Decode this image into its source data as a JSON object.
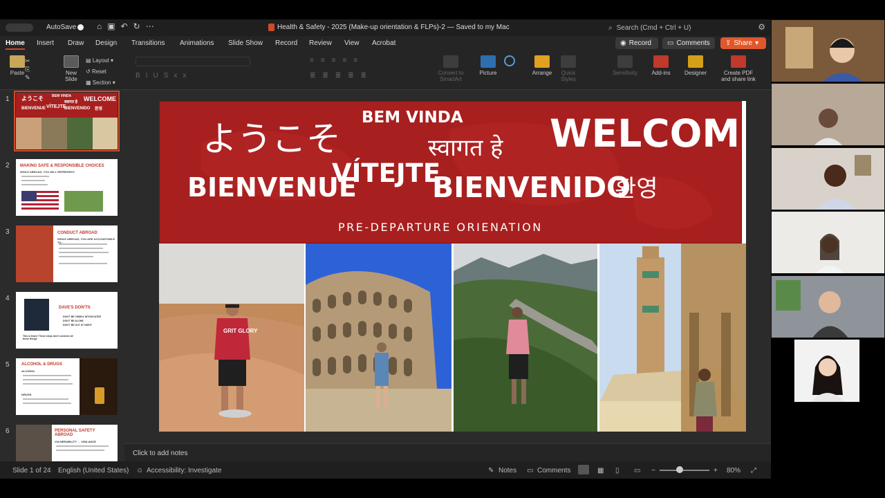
{
  "titlebar": {
    "autosave_label": "AutoSave",
    "document_title": "Health & Safety - 2025 (Make-up orientation & FLPs)-2 — Saved to my Mac",
    "search_placeholder": "Search (Cmd + Ctrl + U)"
  },
  "tabs": [
    "Home",
    "Insert",
    "Draw",
    "Design",
    "Transitions",
    "Animations",
    "Slide Show",
    "Record",
    "Review",
    "View",
    "Acrobat"
  ],
  "actions": {
    "record": "Record",
    "comments": "Comments",
    "share": "Share"
  },
  "ribbon": {
    "paste": "Paste",
    "new_slide": "New Slide",
    "layout": "Layout",
    "reset": "Reset",
    "section": "Section",
    "convert_smartart": "Convert to SmartArt",
    "picture": "Picture",
    "arrange": "Arrange",
    "quick_styles": "Quick Styles",
    "sensitivity": "Sensitivity",
    "addins": "Add-ins",
    "designer": "Designer",
    "create_pdf": "Create PDF and share link"
  },
  "thumbnails": [
    {
      "num": "1",
      "words": [
        "ようこそ",
        "BEM VINDA",
        "स्वागत हे",
        "WELCOME",
        "BIENVENUE",
        "VÍTEJTE",
        "BIENVENIDO",
        "환영"
      ]
    },
    {
      "num": "2",
      "title": "MAKING SAFE & RESPONSIBLE CHOICES",
      "sub": "WHILE ABROAD, YOU WILL REPRESENT:"
    },
    {
      "num": "3",
      "title": "CONDUCT ABROAD",
      "sub": "WHILE ABROAD, YOU ARE ACCOUNTABLE TO:"
    },
    {
      "num": "4",
      "title": "DAVE'S DON'TS",
      "items": [
        "DON'T BE VISIBLY INTOXICATED",
        "DON'T BE ALONE",
        "DON'T BE OUT AT NIGHT"
      ],
      "caption": "This is Dave! These steps don't condone all these things"
    },
    {
      "num": "5",
      "title": "ALCOHOL & DRUGS",
      "sub": "ALCOHOL",
      "sub2": "DRUGS"
    },
    {
      "num": "6",
      "title": "PERSONAL SAFETY ABROAD",
      "sub": "VULNERABILITY → VIGILANCE"
    }
  ],
  "slide": {
    "words": {
      "japanese": "ようこそ",
      "portuguese": "BEM VINDA",
      "hindi": "स्वागत हे",
      "english": "WELCOME",
      "french": "BIENVENUE",
      "czech": "VÍTEJTE",
      "spanish": "BIENVENIDO",
      "korean": "환영"
    },
    "subtitle": "PRE-DEPARTURE ORIENATION",
    "shirt_text": "GRIT GLORY"
  },
  "notes_placeholder": "Click to add notes",
  "status": {
    "slide_count": "Slide 1 of 24",
    "language": "English (United States)",
    "accessibility": "Accessibility: Investigate",
    "notes": "Notes",
    "comments": "Comments",
    "zoom": "80%"
  },
  "colors": {
    "accent": "#d04a2a",
    "banner": "#a81f1f",
    "share": "#e0582a"
  }
}
